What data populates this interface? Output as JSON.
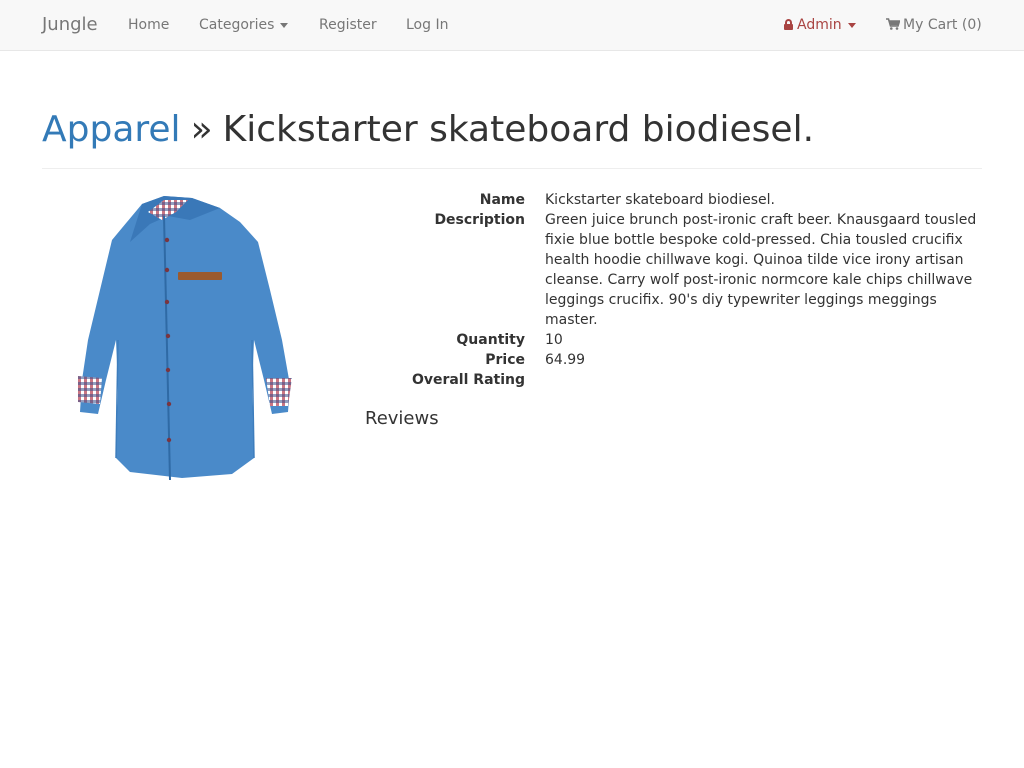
{
  "navbar": {
    "brand": "Jungle",
    "links": {
      "home": "Home",
      "categories": "Categories",
      "register": "Register",
      "login": "Log In"
    },
    "admin": "Admin",
    "cart": "My Cart (0)"
  },
  "page": {
    "category": "Apparel",
    "separator": "»",
    "product_title": "Kickstarter skateboard biodiesel."
  },
  "product": {
    "image_icon": "denim-shirt-image",
    "details": [
      {
        "label": "Name",
        "value": "Kickstarter skateboard biodiesel."
      },
      {
        "label": "Description",
        "value": "Green juice brunch post-ironic craft beer. Knausgaard tousled fixie blue bottle bespoke cold-pressed. Chia tousled crucifix health hoodie chillwave kogi. Quinoa tilde vice irony artisan cleanse. Carry wolf post-ironic normcore kale chips chillwave leggings crucifix. 90's diy typewriter leggings meggings master."
      },
      {
        "label": "Quantity",
        "value": "10"
      },
      {
        "label": "Price",
        "value": "64.99"
      },
      {
        "label": "Overall Rating",
        "value": ""
      }
    ]
  },
  "reviews": {
    "heading": "Reviews"
  },
  "colors": {
    "link": "#337ab7",
    "admin": "#a94442",
    "navbar_bg": "#f8f8f8"
  }
}
